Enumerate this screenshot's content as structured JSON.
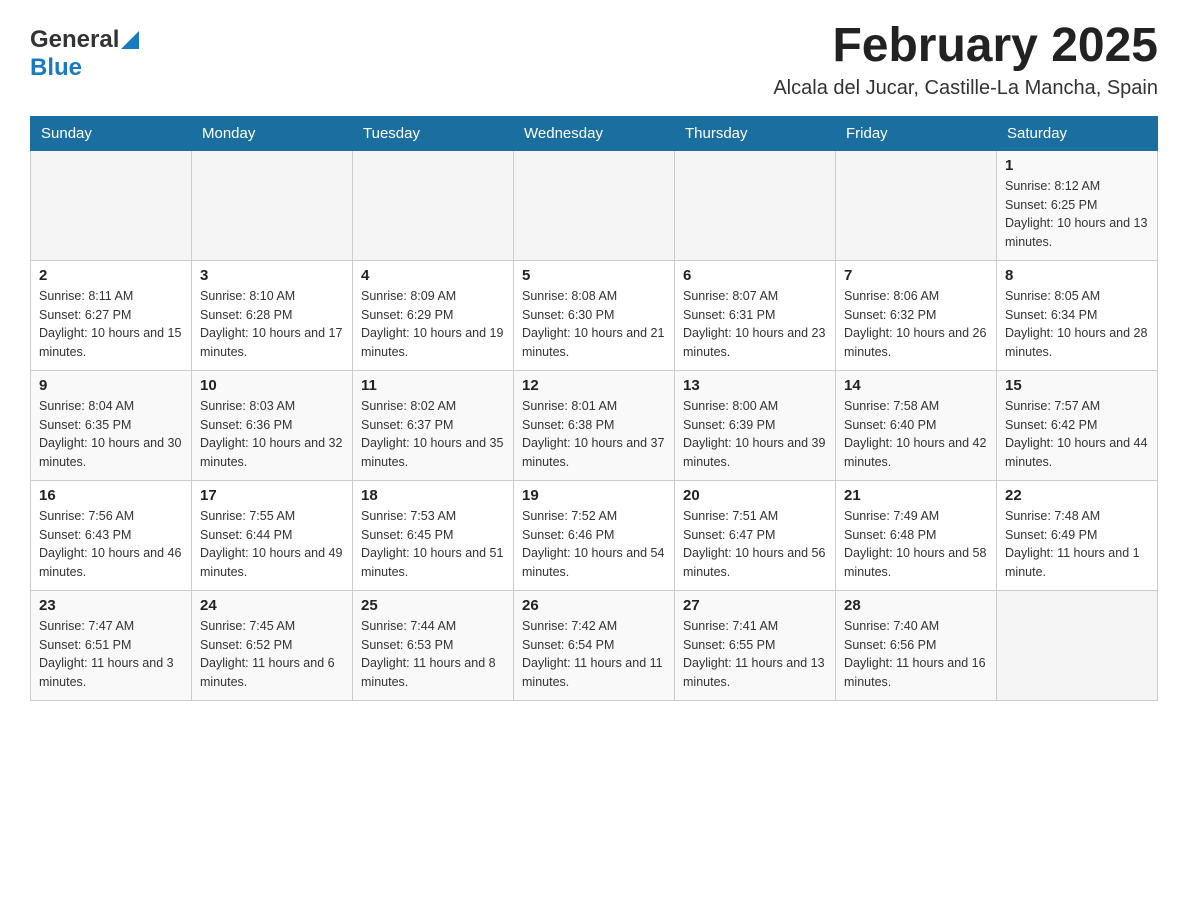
{
  "header": {
    "logo_general": "General",
    "logo_blue": "Blue",
    "month_title": "February 2025",
    "location": "Alcala del Jucar, Castille-La Mancha, Spain"
  },
  "days_of_week": [
    "Sunday",
    "Monday",
    "Tuesday",
    "Wednesday",
    "Thursday",
    "Friday",
    "Saturday"
  ],
  "weeks": [
    [
      {
        "day": "",
        "info": ""
      },
      {
        "day": "",
        "info": ""
      },
      {
        "day": "",
        "info": ""
      },
      {
        "day": "",
        "info": ""
      },
      {
        "day": "",
        "info": ""
      },
      {
        "day": "",
        "info": ""
      },
      {
        "day": "1",
        "info": "Sunrise: 8:12 AM\nSunset: 6:25 PM\nDaylight: 10 hours and 13 minutes."
      }
    ],
    [
      {
        "day": "2",
        "info": "Sunrise: 8:11 AM\nSunset: 6:27 PM\nDaylight: 10 hours and 15 minutes."
      },
      {
        "day": "3",
        "info": "Sunrise: 8:10 AM\nSunset: 6:28 PM\nDaylight: 10 hours and 17 minutes."
      },
      {
        "day": "4",
        "info": "Sunrise: 8:09 AM\nSunset: 6:29 PM\nDaylight: 10 hours and 19 minutes."
      },
      {
        "day": "5",
        "info": "Sunrise: 8:08 AM\nSunset: 6:30 PM\nDaylight: 10 hours and 21 minutes."
      },
      {
        "day": "6",
        "info": "Sunrise: 8:07 AM\nSunset: 6:31 PM\nDaylight: 10 hours and 23 minutes."
      },
      {
        "day": "7",
        "info": "Sunrise: 8:06 AM\nSunset: 6:32 PM\nDaylight: 10 hours and 26 minutes."
      },
      {
        "day": "8",
        "info": "Sunrise: 8:05 AM\nSunset: 6:34 PM\nDaylight: 10 hours and 28 minutes."
      }
    ],
    [
      {
        "day": "9",
        "info": "Sunrise: 8:04 AM\nSunset: 6:35 PM\nDaylight: 10 hours and 30 minutes."
      },
      {
        "day": "10",
        "info": "Sunrise: 8:03 AM\nSunset: 6:36 PM\nDaylight: 10 hours and 32 minutes."
      },
      {
        "day": "11",
        "info": "Sunrise: 8:02 AM\nSunset: 6:37 PM\nDaylight: 10 hours and 35 minutes."
      },
      {
        "day": "12",
        "info": "Sunrise: 8:01 AM\nSunset: 6:38 PM\nDaylight: 10 hours and 37 minutes."
      },
      {
        "day": "13",
        "info": "Sunrise: 8:00 AM\nSunset: 6:39 PM\nDaylight: 10 hours and 39 minutes."
      },
      {
        "day": "14",
        "info": "Sunrise: 7:58 AM\nSunset: 6:40 PM\nDaylight: 10 hours and 42 minutes."
      },
      {
        "day": "15",
        "info": "Sunrise: 7:57 AM\nSunset: 6:42 PM\nDaylight: 10 hours and 44 minutes."
      }
    ],
    [
      {
        "day": "16",
        "info": "Sunrise: 7:56 AM\nSunset: 6:43 PM\nDaylight: 10 hours and 46 minutes."
      },
      {
        "day": "17",
        "info": "Sunrise: 7:55 AM\nSunset: 6:44 PM\nDaylight: 10 hours and 49 minutes."
      },
      {
        "day": "18",
        "info": "Sunrise: 7:53 AM\nSunset: 6:45 PM\nDaylight: 10 hours and 51 minutes."
      },
      {
        "day": "19",
        "info": "Sunrise: 7:52 AM\nSunset: 6:46 PM\nDaylight: 10 hours and 54 minutes."
      },
      {
        "day": "20",
        "info": "Sunrise: 7:51 AM\nSunset: 6:47 PM\nDaylight: 10 hours and 56 minutes."
      },
      {
        "day": "21",
        "info": "Sunrise: 7:49 AM\nSunset: 6:48 PM\nDaylight: 10 hours and 58 minutes."
      },
      {
        "day": "22",
        "info": "Sunrise: 7:48 AM\nSunset: 6:49 PM\nDaylight: 11 hours and 1 minute."
      }
    ],
    [
      {
        "day": "23",
        "info": "Sunrise: 7:47 AM\nSunset: 6:51 PM\nDaylight: 11 hours and 3 minutes."
      },
      {
        "day": "24",
        "info": "Sunrise: 7:45 AM\nSunset: 6:52 PM\nDaylight: 11 hours and 6 minutes."
      },
      {
        "day": "25",
        "info": "Sunrise: 7:44 AM\nSunset: 6:53 PM\nDaylight: 11 hours and 8 minutes."
      },
      {
        "day": "26",
        "info": "Sunrise: 7:42 AM\nSunset: 6:54 PM\nDaylight: 11 hours and 11 minutes."
      },
      {
        "day": "27",
        "info": "Sunrise: 7:41 AM\nSunset: 6:55 PM\nDaylight: 11 hours and 13 minutes."
      },
      {
        "day": "28",
        "info": "Sunrise: 7:40 AM\nSunset: 6:56 PM\nDaylight: 11 hours and 16 minutes."
      },
      {
        "day": "",
        "info": ""
      }
    ]
  ]
}
